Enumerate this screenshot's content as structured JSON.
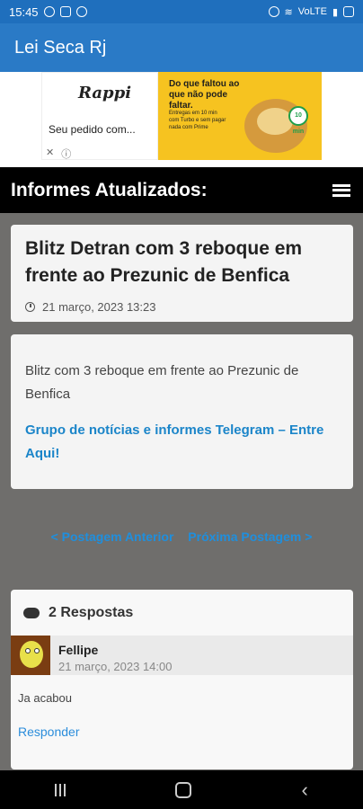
{
  "statusbar": {
    "time": "15:45",
    "right_text": "VoLTE"
  },
  "appbar": {
    "title": "Lei Seca Rj"
  },
  "ad": {
    "logo": "Rappi",
    "left_text": "Seu pedido com...",
    "headline": "Do que faltou ao que não pode faltar.",
    "subtext": "Entregas em 10 min com Turbo e sem pagar nada com Prime",
    "badge": "10 min"
  },
  "titlebar": {
    "title": "Informes Atualizados:"
  },
  "post": {
    "title": "Blitz Detran com 3 reboque em frente ao Prezunic de Benfica",
    "date": "21 março, 2023 13:23"
  },
  "content": {
    "text": "Blitz com 3 reboque em frente ao Prezunic de Benfica",
    "telegram_link": "Grupo de notícias e informes Telegram – Entre Aqui!"
  },
  "postnav": {
    "prev": "< Postagem Anterior",
    "next": "Próxima Postagem >"
  },
  "comments": {
    "heading": "2 Respostas",
    "items": [
      {
        "name": "Fellipe",
        "date": "21 março, 2023 14:00",
        "text": "Ja acabou",
        "reply": "Responder"
      }
    ]
  }
}
